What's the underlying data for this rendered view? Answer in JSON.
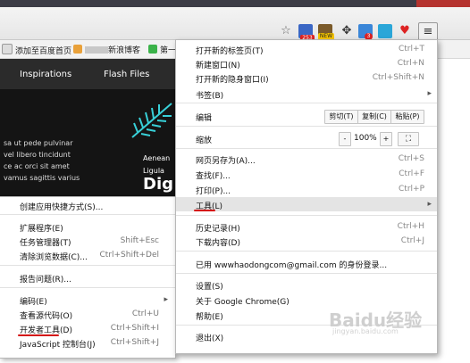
{
  "toolbar": {
    "badges": [
      "253",
      "NEW",
      "3"
    ]
  },
  "bookmarks": [
    {
      "label": "添加至百度首页"
    },
    {
      "label": "新浪博客"
    },
    {
      "label": "第一"
    }
  ],
  "page": {
    "nav": [
      "Inspirations",
      "Flash Files"
    ],
    "lorem": [
      "sa ut pede pulvinar",
      "vel libero tincidunt",
      "ce ac orci sit amet",
      "vamus sagittis varius"
    ],
    "side_words": [
      "Aenean",
      "Ligula",
      "Dig"
    ]
  },
  "menu": {
    "new_tab": "打开新的标签页(T)",
    "new_tab_sc": "Ctrl+T",
    "new_window": "新建窗口(N)",
    "new_window_sc": "Ctrl+N",
    "incognito": "打开新的隐身窗口(I)",
    "incognito_sc": "Ctrl+Shift+N",
    "bookmarks": "书签(B)",
    "edit": "编辑",
    "cut": "剪切(T)",
    "copy": "复制(C)",
    "paste": "粘贴(P)",
    "zoom": "缩放",
    "zoom_minus": "-",
    "zoom_value": "100%",
    "zoom_plus": "+",
    "save_as": "网页另存为(A)...",
    "save_as_sc": "Ctrl+S",
    "find": "查找(F)...",
    "find_sc": "Ctrl+F",
    "print": "打印(P)...",
    "print_sc": "Ctrl+P",
    "tools": "工具(L)",
    "history": "历史记录(H)",
    "history_sc": "Ctrl+H",
    "downloads": "下载内容(D)",
    "downloads_sc": "Ctrl+J",
    "signed_in": "已用 wwwhaodongcom@gmail.com 的身份登录...",
    "settings": "设置(S)",
    "about": "关于 Google Chrome(G)",
    "help": "帮助(E)",
    "exit": "退出(X)"
  },
  "submenu": {
    "create_shortcut": "创建应用快捷方式(S)...",
    "extensions": "扩展程序(E)",
    "task_manager": "任务管理器(T)",
    "task_manager_sc": "Shift+Esc",
    "clear_data": "清除浏览数据(C)...",
    "clear_data_sc": "Ctrl+Shift+Del",
    "report": "报告问题(R)...",
    "encoding": "编码(E)",
    "view_source": "查看源代码(O)",
    "view_source_sc": "Ctrl+U",
    "devtools": "开发者工具(D)",
    "devtools_sc": "Ctrl+Shift+I",
    "js_console": "JavaScript 控制台(J)",
    "js_console_sc": "Ctrl+Shift+J"
  },
  "watermark": {
    "text": "Baidu经验",
    "sub": "jingyan.baidu.com"
  },
  "colors": {
    "annotation": "#d41010",
    "highlight": "#e4e4e4"
  }
}
